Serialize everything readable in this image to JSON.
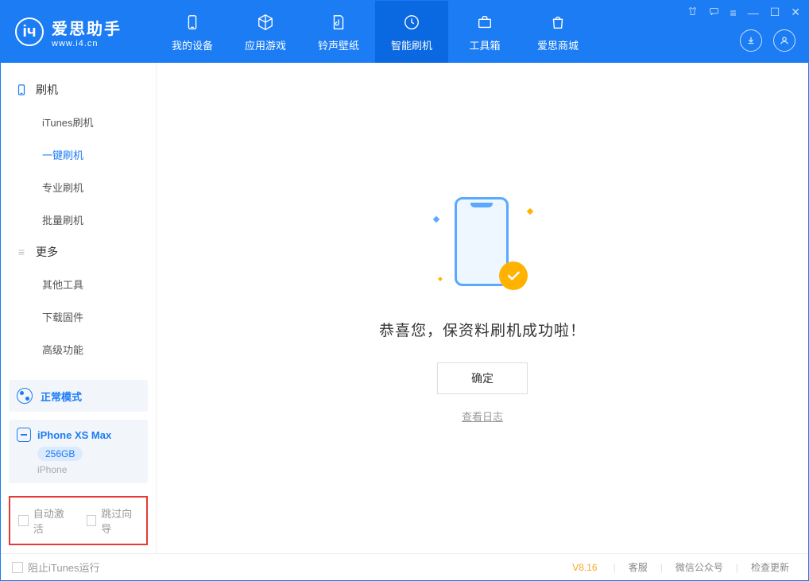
{
  "app": {
    "name_cn": "爱思助手",
    "name_en": "www.i4.cn"
  },
  "nav": {
    "items": [
      {
        "label": "我的设备"
      },
      {
        "label": "应用游戏"
      },
      {
        "label": "铃声壁纸"
      },
      {
        "label": "智能刷机"
      },
      {
        "label": "工具箱"
      },
      {
        "label": "爱思商城"
      }
    ]
  },
  "sidebar": {
    "group1_title": "刷机",
    "group1_items": [
      {
        "label": "iTunes刷机"
      },
      {
        "label": "一键刷机"
      },
      {
        "label": "专业刷机"
      },
      {
        "label": "批量刷机"
      }
    ],
    "group2_title": "更多",
    "group2_items": [
      {
        "label": "其他工具"
      },
      {
        "label": "下载固件"
      },
      {
        "label": "高级功能"
      }
    ],
    "mode_label": "正常模式",
    "device_name": "iPhone XS Max",
    "device_capacity": "256GB",
    "device_type": "iPhone",
    "chk_auto_activate": "自动激活",
    "chk_skip_guide": "跳过向导"
  },
  "content": {
    "success_message": "恭喜您，保资料刷机成功啦！",
    "confirm_button": "确定",
    "view_log": "查看日志"
  },
  "footer": {
    "block_itunes": "阻止iTunes运行",
    "version": "V8.16",
    "link_service": "客服",
    "link_wechat": "微信公众号",
    "link_update": "检查更新"
  }
}
